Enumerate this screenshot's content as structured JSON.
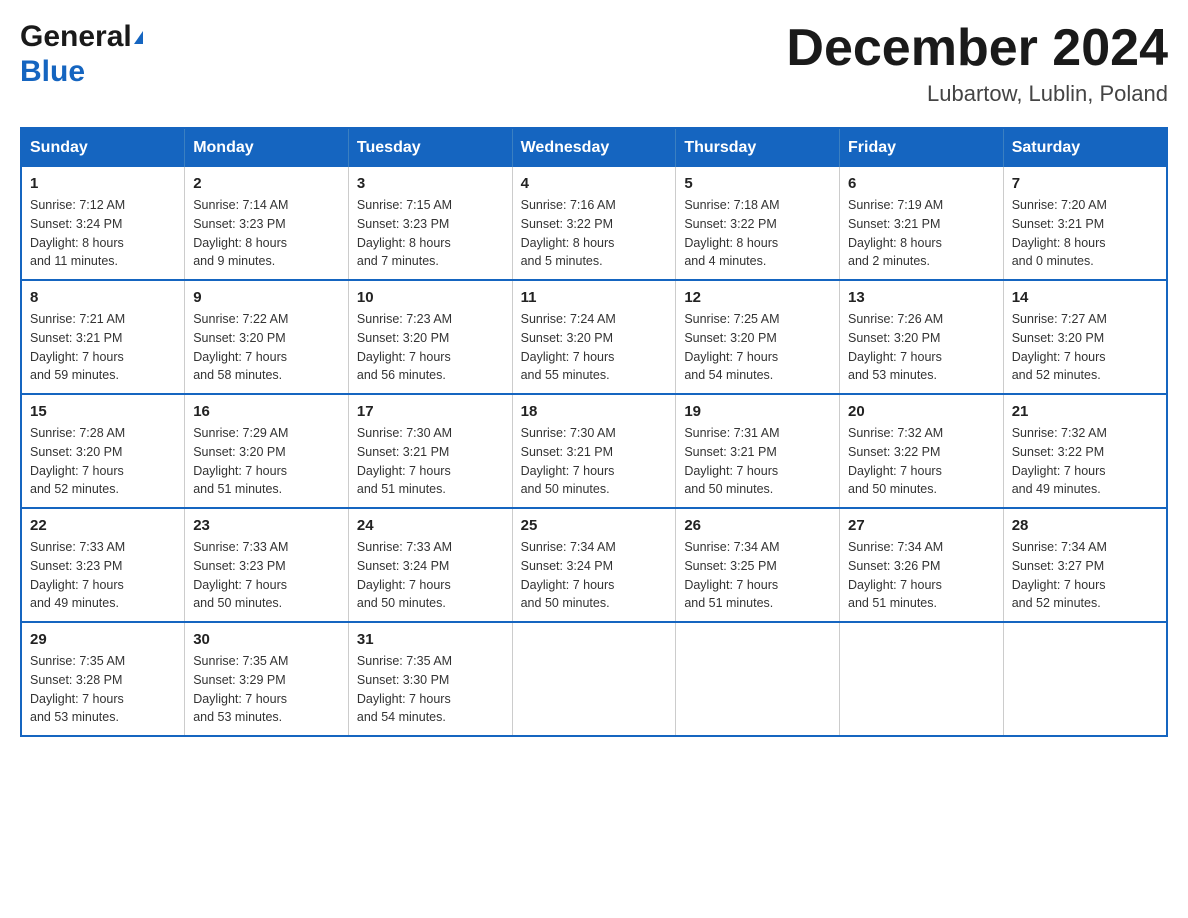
{
  "header": {
    "logo_general": "General",
    "logo_blue": "Blue",
    "month_title": "December 2024",
    "location": "Lubartow, Lublin, Poland"
  },
  "days_of_week": [
    "Sunday",
    "Monday",
    "Tuesday",
    "Wednesday",
    "Thursday",
    "Friday",
    "Saturday"
  ],
  "weeks": [
    [
      {
        "day": "1",
        "sunrise": "7:12 AM",
        "sunset": "3:24 PM",
        "daylight": "8 hours and 11 minutes."
      },
      {
        "day": "2",
        "sunrise": "7:14 AM",
        "sunset": "3:23 PM",
        "daylight": "8 hours and 9 minutes."
      },
      {
        "day": "3",
        "sunrise": "7:15 AM",
        "sunset": "3:23 PM",
        "daylight": "8 hours and 7 minutes."
      },
      {
        "day": "4",
        "sunrise": "7:16 AM",
        "sunset": "3:22 PM",
        "daylight": "8 hours and 5 minutes."
      },
      {
        "day": "5",
        "sunrise": "7:18 AM",
        "sunset": "3:22 PM",
        "daylight": "8 hours and 4 minutes."
      },
      {
        "day": "6",
        "sunrise": "7:19 AM",
        "sunset": "3:21 PM",
        "daylight": "8 hours and 2 minutes."
      },
      {
        "day": "7",
        "sunrise": "7:20 AM",
        "sunset": "3:21 PM",
        "daylight": "8 hours and 0 minutes."
      }
    ],
    [
      {
        "day": "8",
        "sunrise": "7:21 AM",
        "sunset": "3:21 PM",
        "daylight": "7 hours and 59 minutes."
      },
      {
        "day": "9",
        "sunrise": "7:22 AM",
        "sunset": "3:20 PM",
        "daylight": "7 hours and 58 minutes."
      },
      {
        "day": "10",
        "sunrise": "7:23 AM",
        "sunset": "3:20 PM",
        "daylight": "7 hours and 56 minutes."
      },
      {
        "day": "11",
        "sunrise": "7:24 AM",
        "sunset": "3:20 PM",
        "daylight": "7 hours and 55 minutes."
      },
      {
        "day": "12",
        "sunrise": "7:25 AM",
        "sunset": "3:20 PM",
        "daylight": "7 hours and 54 minutes."
      },
      {
        "day": "13",
        "sunrise": "7:26 AM",
        "sunset": "3:20 PM",
        "daylight": "7 hours and 53 minutes."
      },
      {
        "day": "14",
        "sunrise": "7:27 AM",
        "sunset": "3:20 PM",
        "daylight": "7 hours and 52 minutes."
      }
    ],
    [
      {
        "day": "15",
        "sunrise": "7:28 AM",
        "sunset": "3:20 PM",
        "daylight": "7 hours and 52 minutes."
      },
      {
        "day": "16",
        "sunrise": "7:29 AM",
        "sunset": "3:20 PM",
        "daylight": "7 hours and 51 minutes."
      },
      {
        "day": "17",
        "sunrise": "7:30 AM",
        "sunset": "3:21 PM",
        "daylight": "7 hours and 51 minutes."
      },
      {
        "day": "18",
        "sunrise": "7:30 AM",
        "sunset": "3:21 PM",
        "daylight": "7 hours and 50 minutes."
      },
      {
        "day": "19",
        "sunrise": "7:31 AM",
        "sunset": "3:21 PM",
        "daylight": "7 hours and 50 minutes."
      },
      {
        "day": "20",
        "sunrise": "7:32 AM",
        "sunset": "3:22 PM",
        "daylight": "7 hours and 50 minutes."
      },
      {
        "day": "21",
        "sunrise": "7:32 AM",
        "sunset": "3:22 PM",
        "daylight": "7 hours and 49 minutes."
      }
    ],
    [
      {
        "day": "22",
        "sunrise": "7:33 AM",
        "sunset": "3:23 PM",
        "daylight": "7 hours and 49 minutes."
      },
      {
        "day": "23",
        "sunrise": "7:33 AM",
        "sunset": "3:23 PM",
        "daylight": "7 hours and 50 minutes."
      },
      {
        "day": "24",
        "sunrise": "7:33 AM",
        "sunset": "3:24 PM",
        "daylight": "7 hours and 50 minutes."
      },
      {
        "day": "25",
        "sunrise": "7:34 AM",
        "sunset": "3:24 PM",
        "daylight": "7 hours and 50 minutes."
      },
      {
        "day": "26",
        "sunrise": "7:34 AM",
        "sunset": "3:25 PM",
        "daylight": "7 hours and 51 minutes."
      },
      {
        "day": "27",
        "sunrise": "7:34 AM",
        "sunset": "3:26 PM",
        "daylight": "7 hours and 51 minutes."
      },
      {
        "day": "28",
        "sunrise": "7:34 AM",
        "sunset": "3:27 PM",
        "daylight": "7 hours and 52 minutes."
      }
    ],
    [
      {
        "day": "29",
        "sunrise": "7:35 AM",
        "sunset": "3:28 PM",
        "daylight": "7 hours and 53 minutes."
      },
      {
        "day": "30",
        "sunrise": "7:35 AM",
        "sunset": "3:29 PM",
        "daylight": "7 hours and 53 minutes."
      },
      {
        "day": "31",
        "sunrise": "7:35 AM",
        "sunset": "3:30 PM",
        "daylight": "7 hours and 54 minutes."
      },
      null,
      null,
      null,
      null
    ]
  ],
  "labels": {
    "sunrise": "Sunrise:",
    "sunset": "Sunset:",
    "daylight": "Daylight:"
  }
}
